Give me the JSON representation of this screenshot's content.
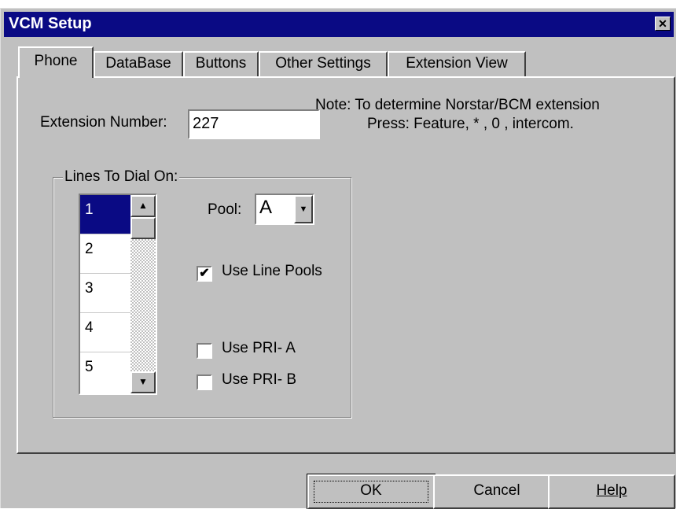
{
  "window": {
    "title": "VCM Setup",
    "close_glyph": "✕"
  },
  "tabs": [
    {
      "label": "Phone",
      "active": true
    },
    {
      "label": "DataBase"
    },
    {
      "label": "Buttons"
    },
    {
      "label": "Other Settings"
    },
    {
      "label": "Extension View"
    }
  ],
  "phone": {
    "extension_label": "Extension Number:",
    "extension_value": "227",
    "note_line1": "Note: To determine Norstar/BCM extension",
    "note_line2": "Press: Feature, * , 0 ,  intercom.",
    "lines_group_label": "Lines To Dial On:",
    "lines": [
      "1",
      "2",
      "3",
      "4",
      "5"
    ],
    "selected_line": "1",
    "pool_label": "Pool:",
    "pool_value": "A",
    "use_line_pools": {
      "label": "Use Line Pools",
      "checked": true
    },
    "use_pri_a": {
      "label": "Use PRI- A",
      "checked": false
    },
    "use_pri_b": {
      "label": "Use PRI- B",
      "checked": false
    }
  },
  "buttons": {
    "ok": "OK",
    "cancel": "Cancel",
    "help": "Help"
  },
  "icons": {
    "scroll_up": "up-arrow-icon",
    "scroll_down": "down-arrow-icon",
    "combo_arrow": "dropdown-arrow-icon",
    "check": "checkmark-icon"
  }
}
